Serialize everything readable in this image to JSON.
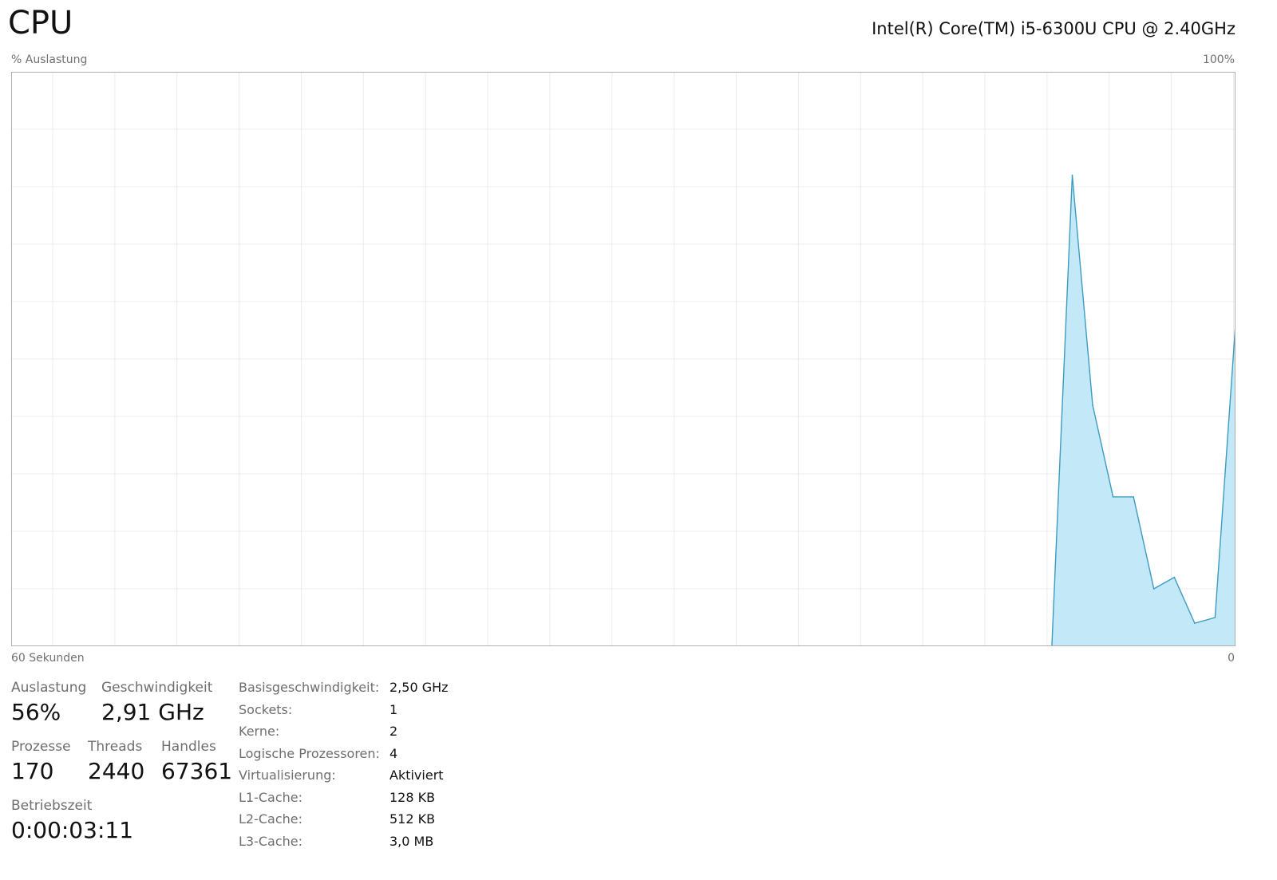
{
  "header": {
    "title": "CPU",
    "model": "Intel(R) Core(TM) i5-6300U CPU @ 2.40GHz"
  },
  "graph": {
    "y_label": "% Auslastung",
    "y_max_label": "100%",
    "x_left_label": "60 Sekunden",
    "x_right_label": "0"
  },
  "chart_data": {
    "type": "area",
    "x_range": [
      60,
      0
    ],
    "ylim": [
      0,
      100
    ],
    "grid": true,
    "colors": {
      "fill": "#c3e8f7",
      "line": "#3d9cc0",
      "grid": "#ececec",
      "border": "#b0b0b0"
    },
    "x": [
      9,
      8,
      7,
      6,
      5,
      4,
      3,
      2,
      1,
      0
    ],
    "values": [
      0,
      82,
      42,
      26,
      26,
      10,
      12,
      4,
      5,
      56
    ]
  },
  "stats": {
    "auslastung": {
      "label": "Auslastung",
      "value": "56%"
    },
    "geschwindigkeit": {
      "label": "Geschwindigkeit",
      "value": "2,91 GHz"
    },
    "prozesse": {
      "label": "Prozesse",
      "value": "170"
    },
    "threads": {
      "label": "Threads",
      "value": "2440"
    },
    "handles": {
      "label": "Handles",
      "value": "67361"
    },
    "betriebszeit": {
      "label": "Betriebszeit",
      "value": "0:00:03:11"
    }
  },
  "specs": [
    {
      "key": "Basisgeschwindigkeit:",
      "value": "2,50 GHz"
    },
    {
      "key": "Sockets:",
      "value": "1"
    },
    {
      "key": "Kerne:",
      "value": "2"
    },
    {
      "key": "Logische Prozessoren:",
      "value": "4"
    },
    {
      "key": "Virtualisierung:",
      "value": "Aktiviert"
    },
    {
      "key": "L1-Cache:",
      "value": "128 KB"
    },
    {
      "key": "L2-Cache:",
      "value": "512 KB"
    },
    {
      "key": "L3-Cache:",
      "value": "3,0 MB"
    }
  ]
}
